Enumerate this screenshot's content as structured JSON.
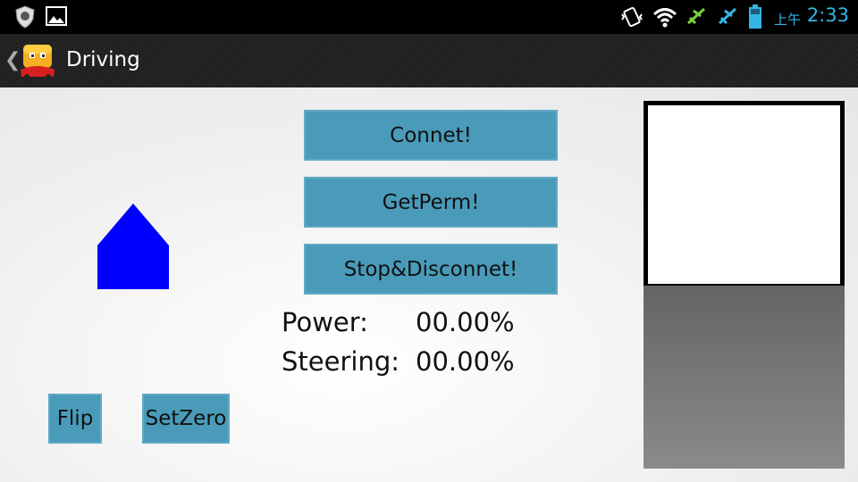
{
  "status_bar": {
    "ampm": "上午",
    "time": "2:33",
    "accent_color": "#33b5e5",
    "icons": [
      "shield-icon",
      "image-notification-icon",
      "vibrate-icon",
      "wifi-icon",
      "airplane-green-icon",
      "airplane-blue-icon",
      "battery-icon"
    ]
  },
  "action_bar": {
    "title": "Driving",
    "up_glyph": "❮"
  },
  "buttons": {
    "connect": "Connet!",
    "get_perm": "GetPerm!",
    "stop_disconnect": "Stop&Disconnet!",
    "flip": "Flip",
    "set_zero": "SetZero",
    "color": "#4a9bba"
  },
  "readouts": {
    "power_label": "Power:",
    "power_value": "00.00%",
    "steering_label": "Steering:",
    "steering_value": "00.00%"
  },
  "direction_indicator": {
    "color": "#0000ff"
  }
}
